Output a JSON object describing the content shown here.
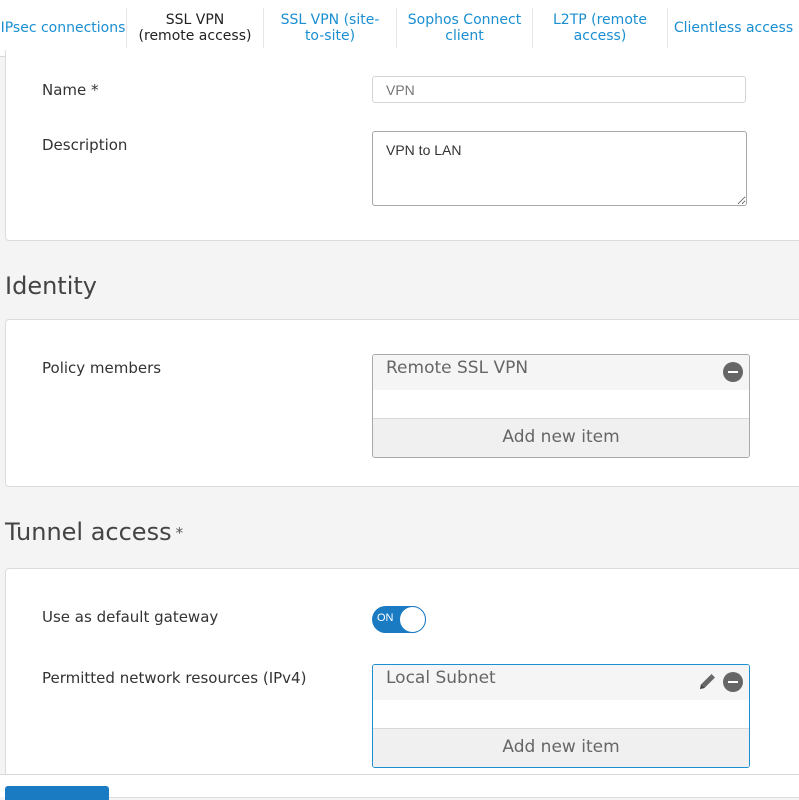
{
  "tabs": [
    {
      "label": "IPsec connections",
      "active": false
    },
    {
      "label": "SSL VPN (remote access)",
      "active": true
    },
    {
      "label": "SSL VPN (site-to-site)",
      "active": false
    },
    {
      "label": "Sophos Connect client",
      "active": false
    },
    {
      "label": "L2TP (remote access)",
      "active": false
    },
    {
      "label": "Clientless access",
      "active": false
    }
  ],
  "general": {
    "name_label": "Name *",
    "name_placeholder": "VPN",
    "description_label": "Description",
    "description_value": "VPN to LAN"
  },
  "identity": {
    "title": "Identity",
    "policy_members_label": "Policy members",
    "members": [
      "Remote SSL VPN"
    ],
    "add_new_item": "Add new item"
  },
  "tunnel": {
    "title": "Tunnel access",
    "required_mark": "*",
    "default_gateway_label": "Use as default gateway",
    "default_gateway_toggle": "ON",
    "permitted_label": "Permitted network resources (IPv4)",
    "resources": [
      "Local Subnet"
    ],
    "add_new_item": "Add new item"
  },
  "colors": {
    "accent": "#1a8fd1",
    "toggle_on": "#1a7bc3"
  }
}
